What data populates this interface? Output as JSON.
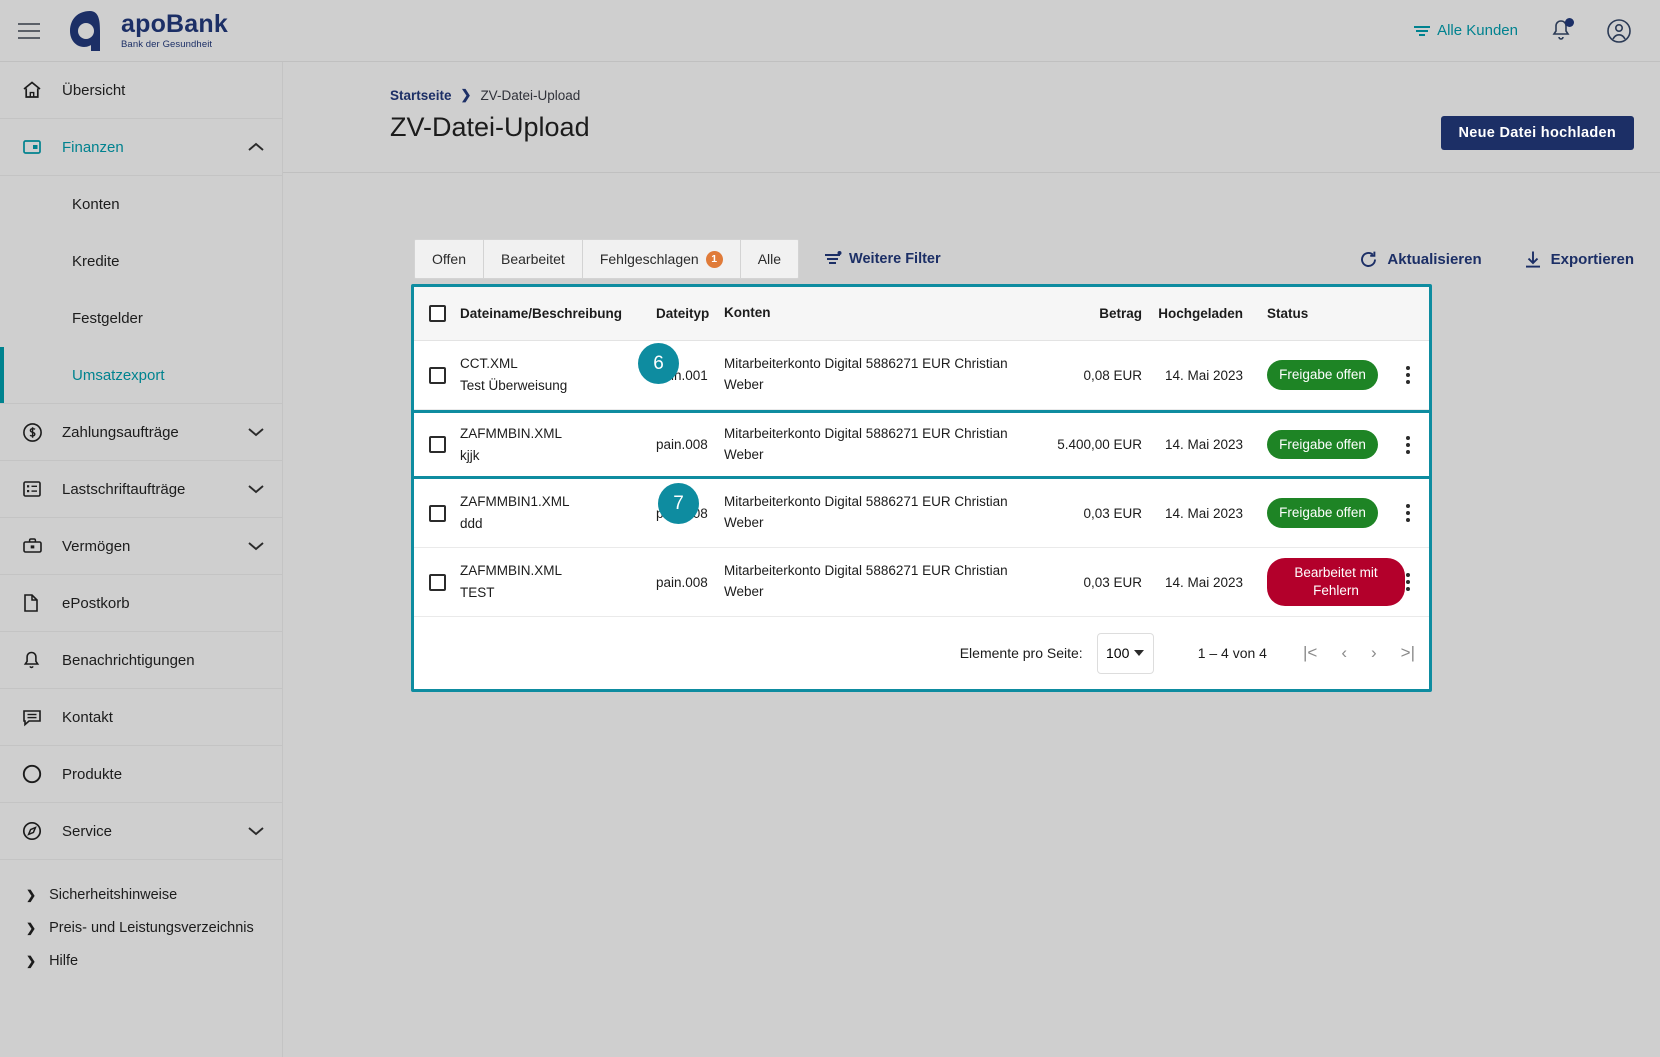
{
  "header": {
    "menu_icon": "hamburger-icon",
    "brand_name": "apoBank",
    "brand_tagline": "Bank der Gesundheit",
    "all_customers_label": "Alle Kunden",
    "filter_icon": "filter-icon",
    "bell_icon": "bell-icon",
    "account_icon": "user-account-icon"
  },
  "sidebar": {
    "items": [
      {
        "label": "Übersicht",
        "icon": "home-icon",
        "chevron": "",
        "type": "item"
      },
      {
        "label": "Finanzen",
        "icon": "finance-icon",
        "chevron": "▲",
        "type": "item",
        "state": "expanded"
      },
      {
        "label": "Konten",
        "type": "sub"
      },
      {
        "label": "Kredite",
        "type": "sub"
      },
      {
        "label": "Festgelder",
        "type": "sub"
      },
      {
        "label": "Umsatzexport",
        "type": "sub",
        "state": "selected"
      },
      {
        "label": "Zahlungsaufträge",
        "icon": "dollar-circle-icon",
        "chevron": "▼",
        "type": "item"
      },
      {
        "label": "Lastschriftaufträge",
        "icon": "list-icon",
        "chevron": "▼",
        "type": "item"
      },
      {
        "label": "Vermögen",
        "icon": "briefcase-icon",
        "chevron": "▼",
        "type": "item"
      },
      {
        "label": "ePostkorb",
        "icon": "document-icon",
        "chevron": "",
        "type": "item"
      },
      {
        "label": "Benachrichtigungen",
        "icon": "bell-icon",
        "chevron": "",
        "type": "item"
      },
      {
        "label": "Kontakt",
        "icon": "chat-icon",
        "chevron": "",
        "type": "item"
      },
      {
        "label": "Produkte",
        "icon": "circle-icon",
        "chevron": "",
        "type": "item"
      },
      {
        "label": "Service",
        "icon": "compass-icon",
        "chevron": "▼",
        "type": "item"
      }
    ],
    "links": [
      {
        "label": "Sicherheitshinweise",
        "icon": "chevron-right-icon"
      },
      {
        "label": "Preis- und Leistungsverzeichnis",
        "icon": "chevron-right-icon"
      },
      {
        "label": "Hilfe",
        "icon": "chevron-right-icon"
      }
    ]
  },
  "breadcrumb": {
    "home": "Startseite",
    "separator": "❯",
    "current": "ZV-Datei-Upload"
  },
  "page": {
    "title": "ZV-Datei-Upload",
    "upload_button": "Neue Datei hochladen"
  },
  "toolbar": {
    "tabs": [
      {
        "label": "Offen",
        "badge": ""
      },
      {
        "label": "Bearbeitet",
        "badge": ""
      },
      {
        "label": "Fehlgeschlagen",
        "badge": "1"
      },
      {
        "label": "Alle",
        "badge": ""
      }
    ],
    "more_filter": "Weitere Filter",
    "more_filter_icon": "filter-settings-icon",
    "refresh": "Aktualisieren",
    "refresh_icon": "refresh-icon",
    "export": "Exportieren",
    "export_icon": "download-icon"
  },
  "table": {
    "columns": {
      "name": "Dateiname/Beschreibung",
      "type": "Dateityp",
      "accounts": "Konten",
      "amount": "Betrag",
      "uploaded": "Hochgeladen",
      "status": "Status"
    },
    "rows": [
      {
        "filename": "CCT.XML",
        "description": "Test Überweisung",
        "filetype": "pain.001",
        "account": "Mitarbeiterkonto Digital 5886271 EUR Christian Weber",
        "amount": "0,08 EUR",
        "uploaded": "14. Mai 2023",
        "status": "Freigabe offen",
        "status_kind": "ok"
      },
      {
        "filename": "ZAFMMBIN.XML",
        "description": "kjjk",
        "filetype": "pain.008",
        "account": "Mitarbeiterkonto Digital 5886271 EUR Christian Weber",
        "amount": "5.400,00 EUR",
        "uploaded": "14. Mai 2023",
        "status": "Freigabe offen",
        "status_kind": "ok"
      },
      {
        "filename": "ZAFMMBIN1.XML",
        "description": "ddd",
        "filetype": "pain.008",
        "account": "Mitarbeiterkonto Digital 5886271 EUR Christian Weber",
        "amount": "0,03 EUR",
        "uploaded": "14. Mai 2023",
        "status": "Freigabe offen",
        "status_kind": "ok"
      },
      {
        "filename": "ZAFMMBIN.XML",
        "description": "TEST",
        "filetype": "pain.008",
        "account": "Mitarbeiterkonto Digital 5886271 EUR Christian Weber",
        "amount": "0,03 EUR",
        "uploaded": "14. Mai 2023",
        "status": "Bearbeitet mit Fehlern",
        "status_kind": "err"
      }
    ]
  },
  "pagination": {
    "per_page_label": "Elemente pro Seite:",
    "per_page_value": "100",
    "range": "1 – 4 von 4",
    "first_icon": "|<",
    "prev_icon": "‹",
    "next_icon": "›",
    "last_icon": ">|"
  },
  "steps": [
    {
      "number": "6"
    },
    {
      "number": "7"
    }
  ],
  "colors": {
    "accent_teal": "#0e8ca0",
    "brand_navy": "#1c2f66",
    "status_ok": "#1e8425",
    "status_error": "#b3002b",
    "badge_orange": "#e07b39"
  }
}
